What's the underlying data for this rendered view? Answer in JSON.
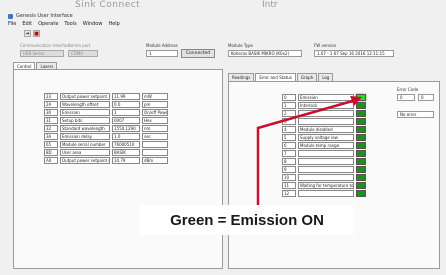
{
  "background_title_left": "Sink Connect",
  "background_title_right": "Intr",
  "window": {
    "title": "Genesis User Interface"
  },
  "menu": [
    "File",
    "Edit",
    "Operate",
    "Tools",
    "Window",
    "Help"
  ],
  "toolbar": {
    "run_icon": "arrow-right",
    "stop_icon": "stop"
  },
  "comm": {
    "label": "Communication Interface",
    "port_label": "Comm port",
    "value1": "USB Serial",
    "value2": "COM4"
  },
  "module_address": {
    "label": "Module Address",
    "value": "1"
  },
  "connect_button": "Connected",
  "module_type": {
    "label": "Module Type",
    "value": "Koheras BASIK MIKRO (K0x2)"
  },
  "fw_version": {
    "label": "FW version",
    "value": "1.07 - 1.07 Sep 16 2016 12:11:15"
  },
  "left_tabs": [
    "Control",
    "Lasers"
  ],
  "register_table": [
    {
      "reg": "23",
      "name": "Output power setpoint",
      "value": "11.99",
      "unit": "mW"
    },
    {
      "reg": "2A",
      "name": "Wavelength offset",
      "value": "0.0",
      "unit": "pm"
    },
    {
      "reg": "30",
      "name": "Emission",
      "value": "1",
      "unit": "On/off Power"
    },
    {
      "reg": "31",
      "name": "Setup bits",
      "value": "0007",
      "unit": "Hex"
    },
    {
      "reg": "32",
      "name": "Standard wavelength",
      "value": "1550.1290",
      "unit": "nm"
    },
    {
      "reg": "3A",
      "name": "Emission delay",
      "value": "1.0",
      "unit": "sec"
    },
    {
      "reg": "65",
      "name": "Module serial number",
      "value": "76000510",
      "unit": ""
    },
    {
      "reg": "8D",
      "name": "User area",
      "value": "BASIK",
      "unit": ""
    },
    {
      "reg": "A0",
      "name": "Output power setpoint (dBm)",
      "value": "10.79",
      "unit": "dBm"
    }
  ],
  "right_tabs": [
    "Readings",
    "Error and Status",
    "Graph",
    "Log"
  ],
  "status_rows": [
    {
      "bit": "0",
      "desc": "Emission",
      "state": "on"
    },
    {
      "bit": "1",
      "desc": "Interlock",
      "state": "on"
    },
    {
      "bit": "2",
      "desc": "",
      "state": "on"
    },
    {
      "bit": "3",
      "desc": "",
      "state": "on"
    },
    {
      "bit": "4",
      "desc": "Module disabled",
      "state": "on"
    },
    {
      "bit": "5",
      "desc": "Supply voltage low",
      "state": "on"
    },
    {
      "bit": "6",
      "desc": "Module temp range",
      "state": "on"
    },
    {
      "bit": "7",
      "desc": "",
      "state": "on"
    },
    {
      "bit": "8",
      "desc": "",
      "state": "on"
    },
    {
      "bit": "9",
      "desc": "",
      "state": "on"
    },
    {
      "bit": "10",
      "desc": "",
      "state": "on"
    },
    {
      "bit": "11",
      "desc": "Waiting for temperature to",
      "state": "on"
    },
    {
      "bit": "12",
      "desc": "",
      "state": "on"
    }
  ],
  "error_code": {
    "label": "Error Code",
    "value": "0",
    "value2": "0",
    "message": "No error"
  },
  "callout": "Green = Emission ON",
  "colors": {
    "accent_red": "#c8102e",
    "indicator_on": "#1e8e1e",
    "indicator_emission": "#2ed82e"
  }
}
